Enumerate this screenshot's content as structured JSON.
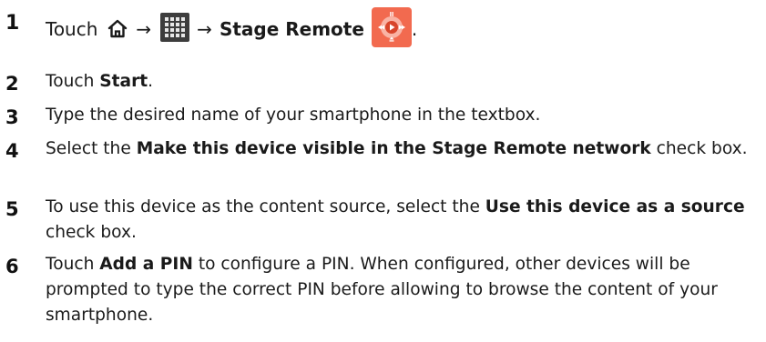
{
  "steps": [
    {
      "number": "1",
      "prefix": "Touch",
      "arrow1": "→",
      "arrow2": "→",
      "target": "Stage Remote",
      "suffix": ".",
      "icons": [
        "home-icon",
        "apps-grid-icon",
        "stage-remote-app-icon"
      ]
    },
    {
      "number": "2",
      "prefix": "Touch ",
      "bold": "Start",
      "suffix": "."
    },
    {
      "number": "3",
      "text": "Type the desired name of your smartphone in the textbox."
    },
    {
      "number": "4",
      "prefix": "Select the ",
      "bold": "Make this device visible in the Stage Remote network",
      "suffix": " check box."
    },
    {
      "number": "5",
      "prefix": "To use this device as the content source, select the ",
      "bold": "Use this device as a source",
      "suffix": " check box."
    },
    {
      "number": "6",
      "prefix": "Touch ",
      "bold": "Add a PIN",
      "suffix": " to configure a PIN. When configured, other devices will be prompted to type the correct PIN before allowing to browse the content of your smartphone."
    }
  ],
  "colors": {
    "text": "#1a1a1a",
    "apps_icon_bg": "#3d3d3d",
    "stage_icon_bg": "#f26a4f"
  }
}
